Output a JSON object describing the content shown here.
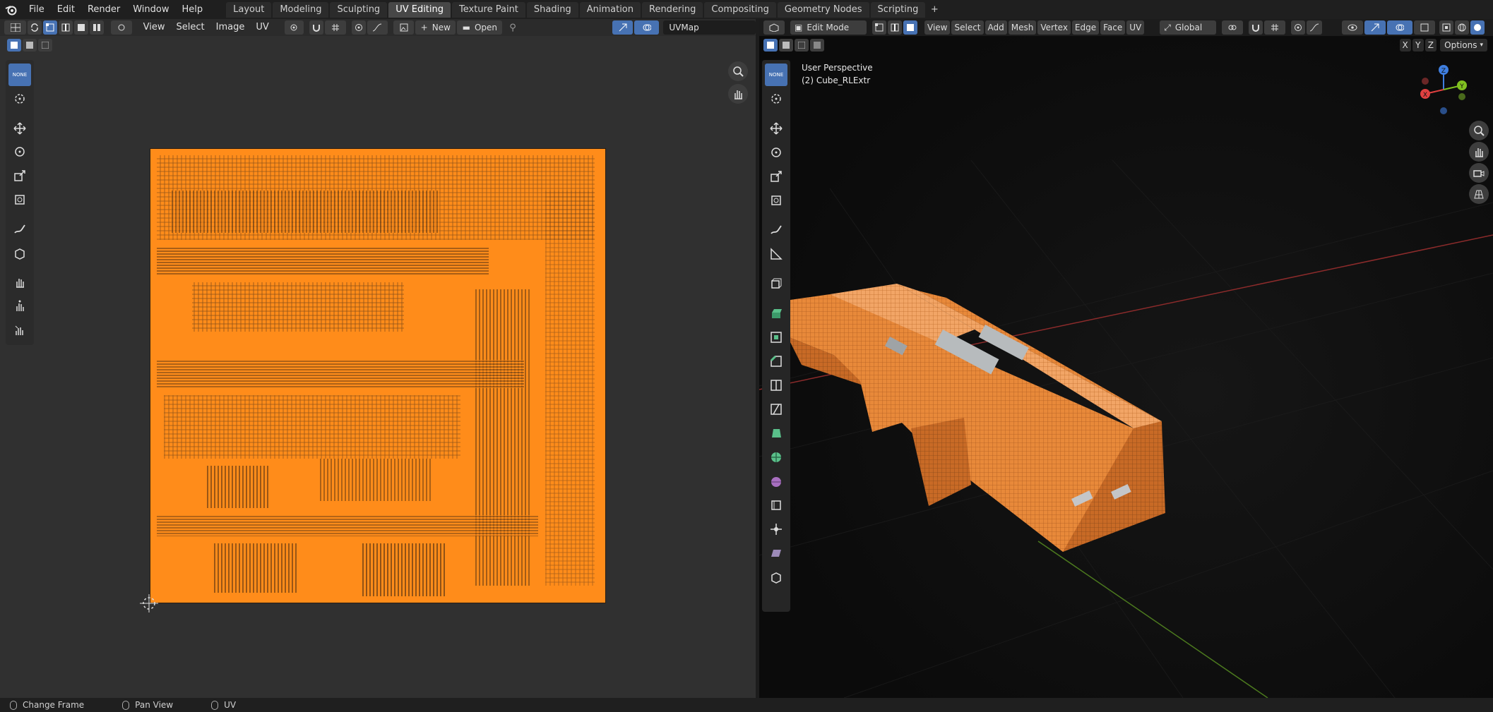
{
  "menu": {
    "items": [
      "File",
      "Edit",
      "Render",
      "Window",
      "Help"
    ]
  },
  "workspaces": {
    "tabs": [
      "Layout",
      "Modeling",
      "Sculpting",
      "UV Editing",
      "Texture Paint",
      "Shading",
      "Animation",
      "Rendering",
      "Compositing",
      "Geometry Nodes",
      "Scripting"
    ],
    "active": "UV Editing"
  },
  "uv_editor": {
    "menus": [
      "View",
      "Select",
      "Image",
      "UV"
    ],
    "new_label": "New",
    "open_label": "Open",
    "uvmap_field": "UVMap",
    "tool_none_label": "NONE"
  },
  "viewport": {
    "mode": "Edit Mode",
    "menus": [
      "View",
      "Select",
      "Add",
      "Mesh",
      "Vertex",
      "Edge",
      "Face",
      "UV"
    ],
    "orientation": "Global",
    "axis_buttons": [
      "X",
      "Y",
      "Z"
    ],
    "options_label": "Options",
    "perspective_label": "User Perspective",
    "object_label": "(2) Cube_RLExtr",
    "tool_none_label": "NONE",
    "gizmo_axes": [
      "Z",
      "Y",
      "X"
    ]
  },
  "statusbar": {
    "items": [
      "Change Frame",
      "Pan View",
      "UV"
    ]
  },
  "colors": {
    "accent": "#4772b3",
    "uv_orange": "#ff8c1a",
    "x_axis": "#e04040",
    "y_axis": "#80c020",
    "z_axis": "#3f7fe0"
  }
}
